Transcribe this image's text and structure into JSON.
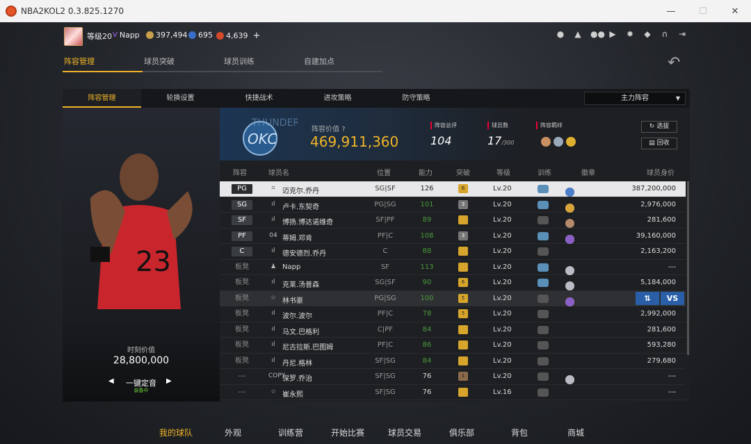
{
  "window": {
    "title": "NBA2KOL2 0.3.825.1270"
  },
  "header": {
    "level": "等级20",
    "vip_badge": "V",
    "username": "Napp",
    "gold": "397,494",
    "stars": "695",
    "points": "4,639",
    "add_label": "+",
    "icons": [
      "user-icon",
      "bell-icon",
      "friends-icon",
      "video-icon",
      "gear-icon",
      "shield-icon",
      "headset-icon",
      "exit-icon"
    ]
  },
  "top_tabs": [
    "阵容管理",
    "球员突破",
    "球员训练",
    "自建加点"
  ],
  "sub_tabs": [
    "阵容管理",
    "轮换设置",
    "快捷战术",
    "进攻策略",
    "防守策略"
  ],
  "dropdown": {
    "value": "主力阵容"
  },
  "featured": {
    "value_label": "时刻价值",
    "value": "28,800,000",
    "action": "一键定音",
    "status": "装备中"
  },
  "summary": {
    "team_value_label": "阵容价值",
    "team_value": "469,911,360",
    "rating_label": "阵容总评",
    "rating": "104",
    "count_label": "球员数",
    "count": "17",
    "count_max": "/300",
    "bond_label": "阵容羁绊",
    "select_btn": "选拔",
    "recycle_btn": "回收"
  },
  "table": {
    "headers": [
      "阵容",
      "球员名",
      "位置",
      "能力",
      "突破",
      "等级",
      "训练",
      "徽章",
      "球员身价"
    ],
    "rows": [
      {
        "slot": "PG",
        "icon": "⌗",
        "name": "迈克尔.乔丹",
        "pos": "SG|SF",
        "abil": "126",
        "brk": "6",
        "lv": "Lv.20",
        "val": "387,200,000",
        "sel": true
      },
      {
        "slot": "SG",
        "icon": "ıl",
        "name": "卢卡.东契奇",
        "pos": "PG|SG",
        "abil": "101",
        "brk": "3",
        "lv": "Lv.20",
        "val": "2,976,000"
      },
      {
        "slot": "SF",
        "icon": "ıl",
        "name": "博扬.博达诺维奇",
        "pos": "SF|PF",
        "abil": "89",
        "brk": "",
        "lv": "Lv.20",
        "val": "281,600"
      },
      {
        "slot": "PF",
        "icon": "04",
        "name": "蒂姆.邓肯",
        "pos": "PF|C",
        "abil": "108",
        "brk": "3",
        "lv": "Lv.20",
        "val": "39,160,000"
      },
      {
        "slot": "C",
        "icon": "ıl",
        "name": "德安德烈.乔丹",
        "pos": "C",
        "abil": "88",
        "brk": "",
        "lv": "Lv.20",
        "val": "2,163,200"
      },
      {
        "slot": "板凳",
        "icon": "♟",
        "name": "Napp",
        "pos": "SF",
        "abil": "113",
        "brk": "",
        "lv": "Lv.20",
        "val": "---"
      },
      {
        "slot": "板凳",
        "icon": "ıl",
        "name": "克莱.汤普森",
        "pos": "SG|SF",
        "abil": "90",
        "brk": "6",
        "lv": "Lv.20",
        "val": "5,184,000"
      },
      {
        "slot": "板凳",
        "icon": "☆",
        "name": "林书豪",
        "pos": "PG|SG",
        "abil": "100",
        "brk": "5",
        "lv": "Lv.20",
        "val": "",
        "hl": true
      },
      {
        "slot": "板凳",
        "icon": "ıl",
        "name": "波尔.波尔",
        "pos": "PF|C",
        "abil": "78",
        "brk": "5",
        "lv": "Lv.20",
        "val": "2,992,000"
      },
      {
        "slot": "板凳",
        "icon": "ıl",
        "name": "马文.巴格利",
        "pos": "C|PF",
        "abil": "84",
        "brk": "",
        "lv": "Lv.20",
        "val": "281,600"
      },
      {
        "slot": "板凳",
        "icon": "ıl",
        "name": "尼古拉斯.巴图姆",
        "pos": "PF|C",
        "abil": "86",
        "brk": "",
        "lv": "Lv.20",
        "val": "593,280"
      },
      {
        "slot": "板凳",
        "icon": "ıl",
        "name": "丹尼.格林",
        "pos": "SF|SG",
        "abil": "84",
        "brk": "",
        "lv": "Lv.20",
        "val": "279,680"
      },
      {
        "slot": "---",
        "icon": "COPY",
        "name": "保罗.乔治",
        "pos": "SF|SG",
        "abil": "76",
        "brk": "1",
        "lv": "Lv.20",
        "val": "---"
      },
      {
        "slot": "---",
        "icon": "☆",
        "name": "崔永熙",
        "pos": "SF|SG",
        "abil": "76",
        "brk": "",
        "lv": "Lv.16",
        "val": "---"
      }
    ],
    "vs_label": "VS",
    "swap_label": "⇅"
  },
  "bottom_nav": [
    "我的球队",
    "外观",
    "训练营",
    "开始比赛",
    "球员交易",
    "俱乐部",
    "背包",
    "商城"
  ],
  "colors": {
    "accent": "#f0b429",
    "panel": "#1d1f23"
  }
}
